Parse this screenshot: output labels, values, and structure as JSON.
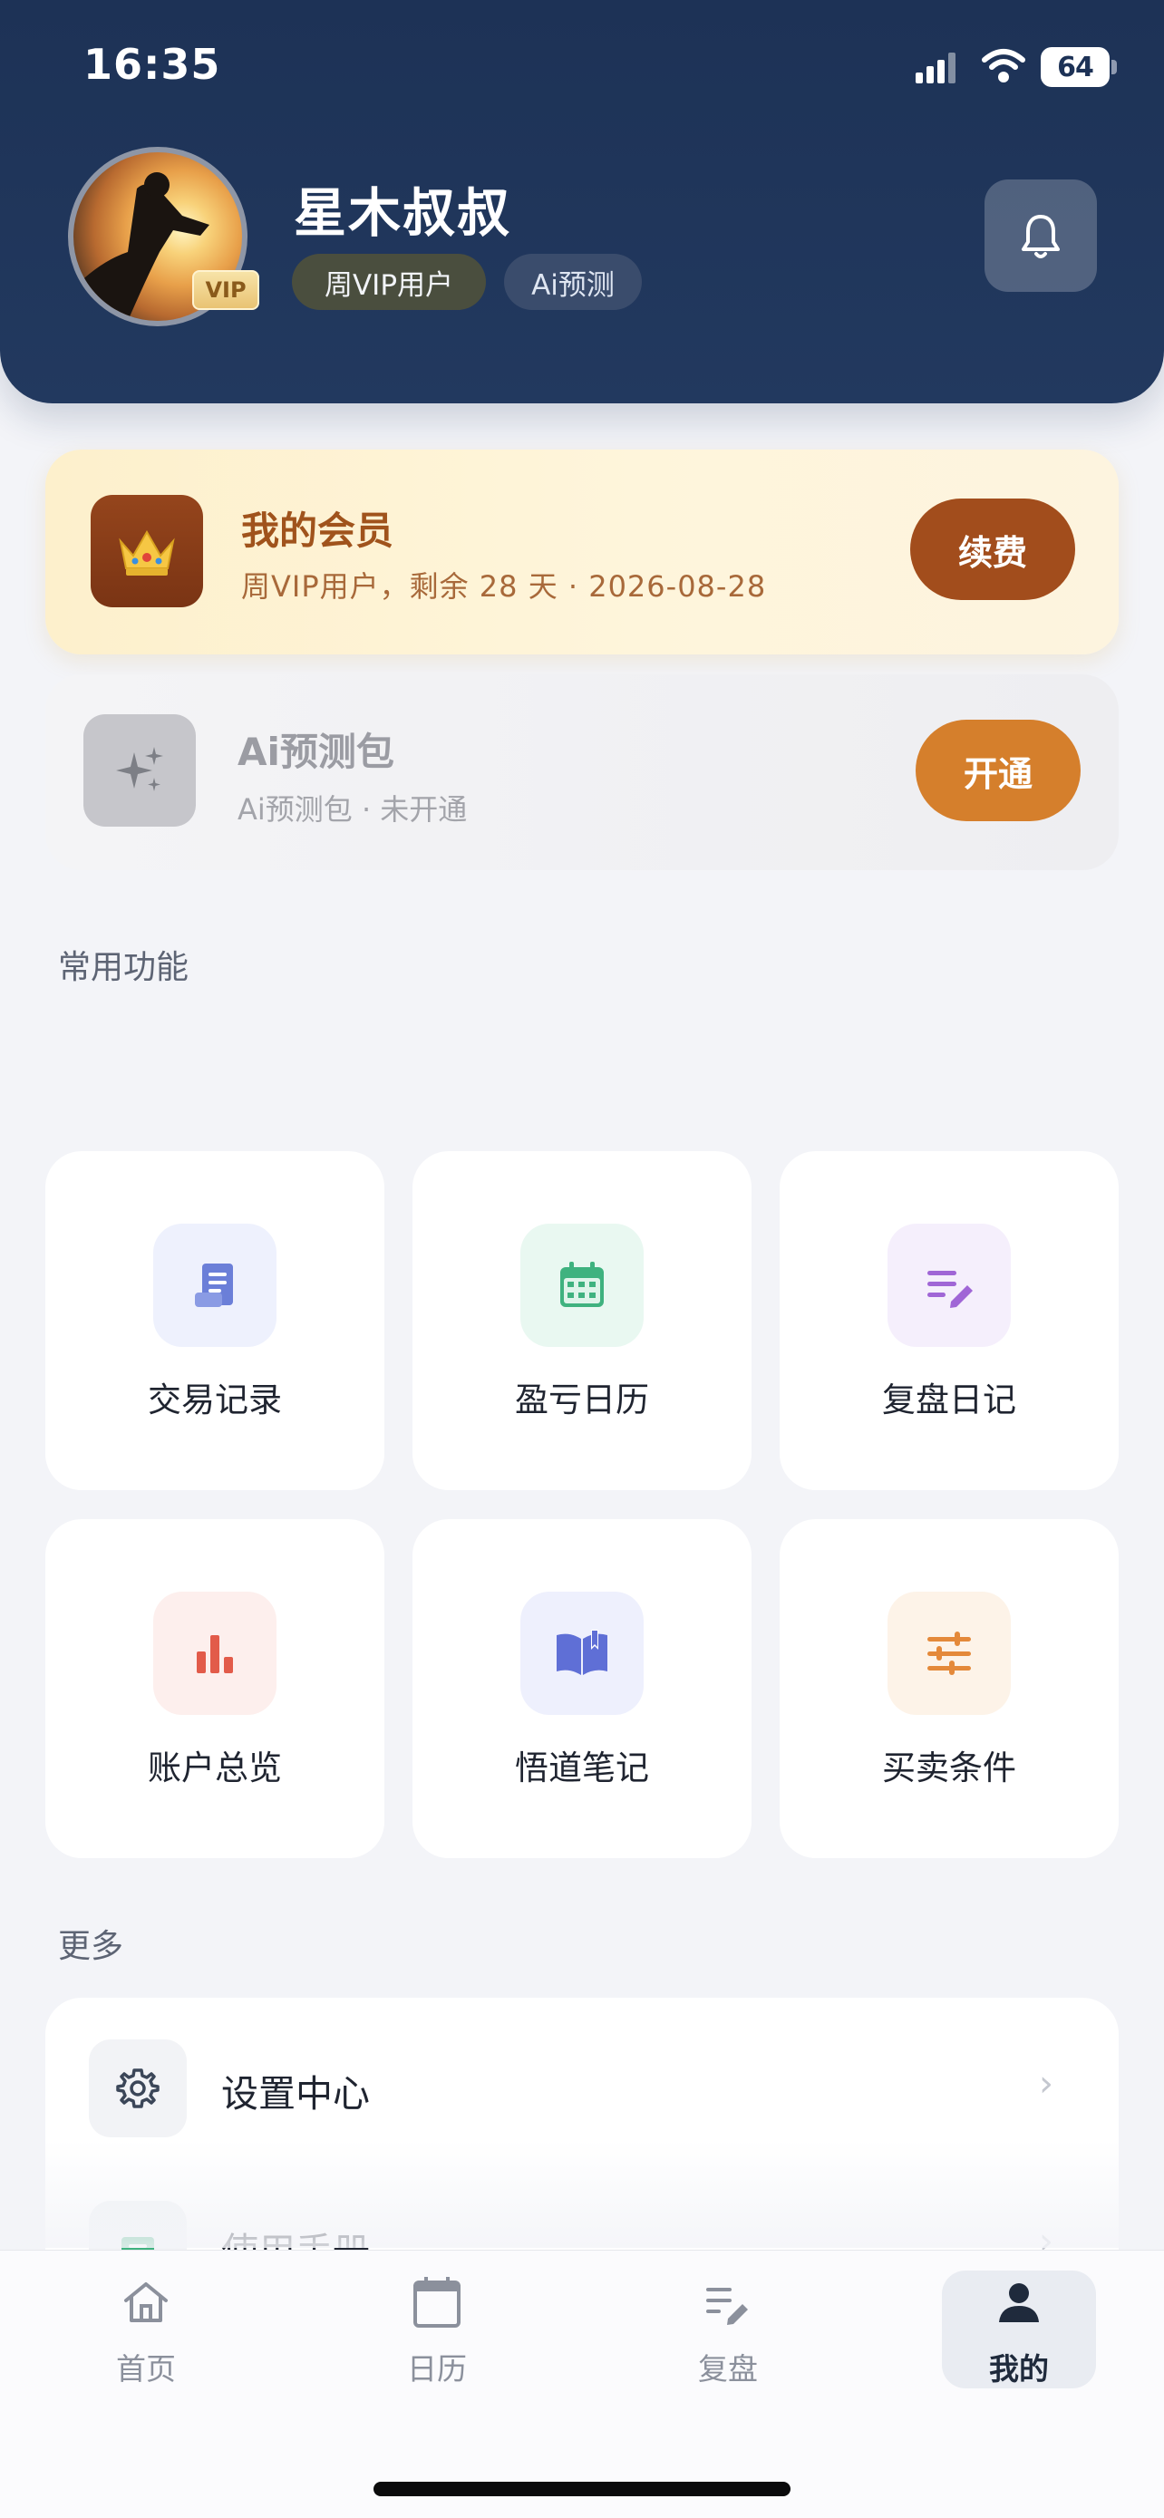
{
  "status_bar": {
    "time": "16:35",
    "battery": "64"
  },
  "profile": {
    "name": "星木叔叔",
    "avatar_badge": "VIP",
    "badges": [
      "周VIP用户",
      "Ai预测"
    ]
  },
  "membership": {
    "title": "我的会员",
    "subtitle": "周VIP用户，剩余 28 天 · 2026-08-28",
    "button": "续费"
  },
  "ai_pack": {
    "title": "Ai预测包",
    "subtitle": "Ai预测包 · 未开通",
    "button": "开通"
  },
  "common_section": {
    "title": "常用功能",
    "items": [
      {
        "label": "交易记录",
        "icon": "receipt-icon",
        "color": "#6b7fd8",
        "bg": "#eef1fd"
      },
      {
        "label": "盈亏日历",
        "icon": "calendar-icon",
        "color": "#3fb27f",
        "bg": "#e9f8f1"
      },
      {
        "label": "复盘日记",
        "icon": "edit-list-icon",
        "color": "#a066d6",
        "bg": "#f5effc"
      },
      {
        "label": "账户总览",
        "icon": "bar-chart-icon",
        "color": "#e25b4a",
        "bg": "#fdefed"
      },
      {
        "label": "悟道笔记",
        "icon": "book-icon",
        "color": "#5f6fd6",
        "bg": "#eef0fd"
      },
      {
        "label": "买卖条件",
        "icon": "sliders-icon",
        "color": "#e4893a",
        "bg": "#fdf3e8"
      }
    ]
  },
  "more_section": {
    "title": "更多",
    "items": [
      {
        "label": "设置中心",
        "icon": "gear-icon"
      },
      {
        "label": "使用手册",
        "icon": "manual-icon"
      }
    ]
  },
  "tabbar": {
    "items": [
      {
        "label": "首页",
        "icon": "home-icon"
      },
      {
        "label": "日历",
        "icon": "calendar-icon"
      },
      {
        "label": "复盘",
        "icon": "edit-list-icon"
      },
      {
        "label": "我的",
        "icon": "user-icon",
        "active": true
      }
    ]
  }
}
